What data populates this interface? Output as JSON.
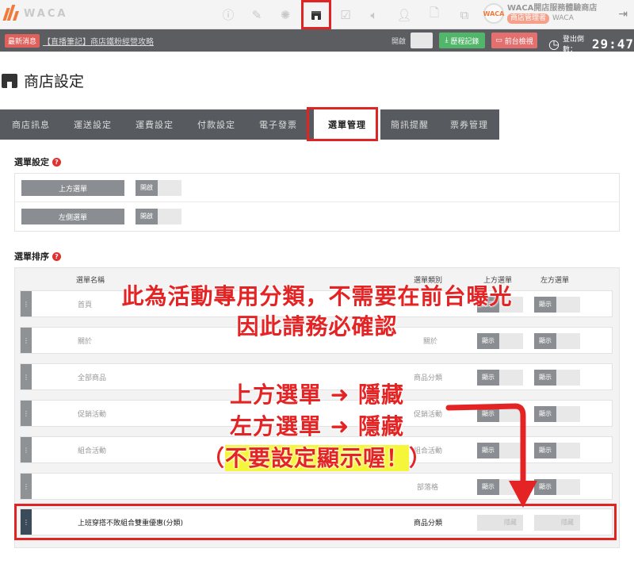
{
  "topnav": {
    "logo_text": "WACA",
    "icons": [
      "info-icon",
      "edit-icon",
      "palette-icon",
      "store-icon",
      "checklist-icon",
      "megaphone-icon",
      "user-icon",
      "document-icon",
      "copy-icon"
    ],
    "store_name": "WACA開店服務體驗商店",
    "store_role": "商店管理者",
    "store_brand": "WACA",
    "avatar_text": "WACA"
  },
  "annbar": {
    "badge": "最新消息",
    "link": "【直播筆記】商店鐵粉經營攻略",
    "open_label": "開啟",
    "record_label": "歷程記錄",
    "preview_label": "前台檢視",
    "timer_label": "登出倒數：",
    "timer_value": "29:47"
  },
  "page": {
    "title": "商店設定"
  },
  "tabs": [
    {
      "label": "商店訊息",
      "active": false
    },
    {
      "label": "運送設定",
      "active": false
    },
    {
      "label": "運費設定",
      "active": false
    },
    {
      "label": "付款設定",
      "active": false
    },
    {
      "label": "電子發票",
      "active": false
    },
    {
      "label": "選單管理",
      "active": true
    },
    {
      "label": "簡訊提醒",
      "active": false
    },
    {
      "label": "票券管理",
      "active": false
    }
  ],
  "menu_settings": {
    "title": "選單設定",
    "rows": [
      {
        "label": "上方選單",
        "toggle": "開啟"
      },
      {
        "label": "左側選單",
        "toggle": "開啟"
      }
    ]
  },
  "menu_sort": {
    "title": "選單排序",
    "headers": {
      "name": "選單名稱",
      "category": "選單類別",
      "top": "上方選單",
      "left": "左方選單"
    },
    "rows": [
      {
        "name": "首頁",
        "category": "",
        "top": "顯示",
        "left": "顯示",
        "top_state": "show",
        "left_state": "show"
      },
      {
        "name": "關於",
        "category": "關於",
        "top": "顯示",
        "left": "顯示",
        "top_state": "show",
        "left_state": "show"
      },
      {
        "name": "全部商品",
        "category": "商品分類",
        "top": "顯示",
        "left": "顯示",
        "top_state": "show",
        "left_state": "show"
      },
      {
        "name": "促銷活動",
        "category": "促銷活動",
        "top": "顯示",
        "left": "顯示",
        "top_state": "show",
        "left_state": "show"
      },
      {
        "name": "組合活動",
        "category": "組合活動",
        "top": "顯示",
        "left": "顯示",
        "top_state": "show",
        "left_state": "show"
      },
      {
        "name": "",
        "category": "部落格",
        "top": "顯示",
        "left": "顯示",
        "top_state": "show",
        "left_state": "show"
      },
      {
        "name": "上班穿搭不敗組合雙重優惠(分類)",
        "category": "商品分類",
        "top": "隱藏",
        "left": "隱藏",
        "top_state": "hide",
        "left_state": "hide"
      }
    ]
  },
  "annotation": {
    "line1": "此為活動專用分類，不需要在前台曝光",
    "line2": "因此請務必確認",
    "line3": "上方選單 ➜ 隱藏",
    "line4": "左方選單 ➜ 隱藏",
    "line5_open": "（",
    "line5_hl": "不要設定顯示喔！",
    "line5_close": "）"
  },
  "colors": {
    "accent_red": "#e02424",
    "tab_bg": "#575a5e",
    "toggle_dark": "#8a8d91"
  }
}
